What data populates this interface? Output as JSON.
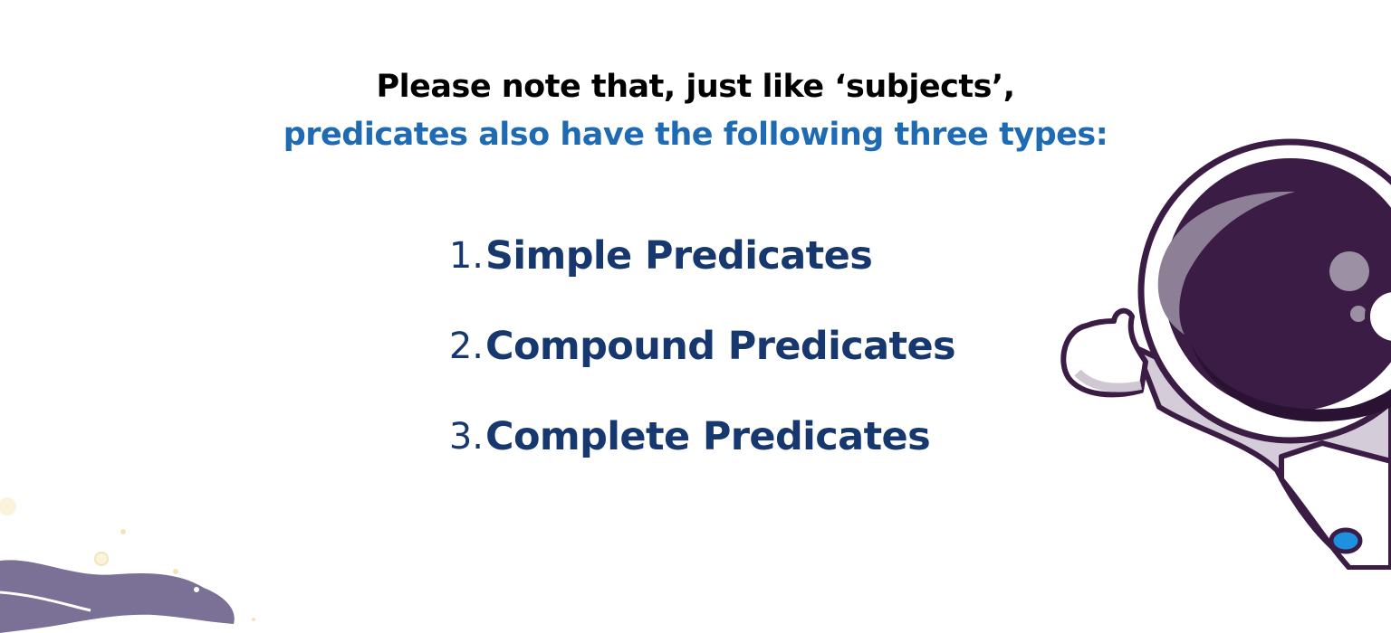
{
  "heading": {
    "line1": "Please note that, just like ‘subjects’,",
    "line2": "predicates also have the following three types:"
  },
  "types": [
    {
      "number": "1.",
      "label": "Simple Predicates"
    },
    {
      "number": "2.",
      "label": "Compound Predicates"
    },
    {
      "number": "3.",
      "label": "Complete Predicates"
    }
  ],
  "illustrations": {
    "astronaut": "astronaut-illustration",
    "planet": "planet-illustration"
  },
  "colors": {
    "heading_black": "#000000",
    "heading_blue": "#1f6bb3",
    "list_navy": "#17386f",
    "helmet_purple": "#3b1c45",
    "suit_lavender": "#cfc8d3",
    "planet_purple": "#7b7196"
  }
}
